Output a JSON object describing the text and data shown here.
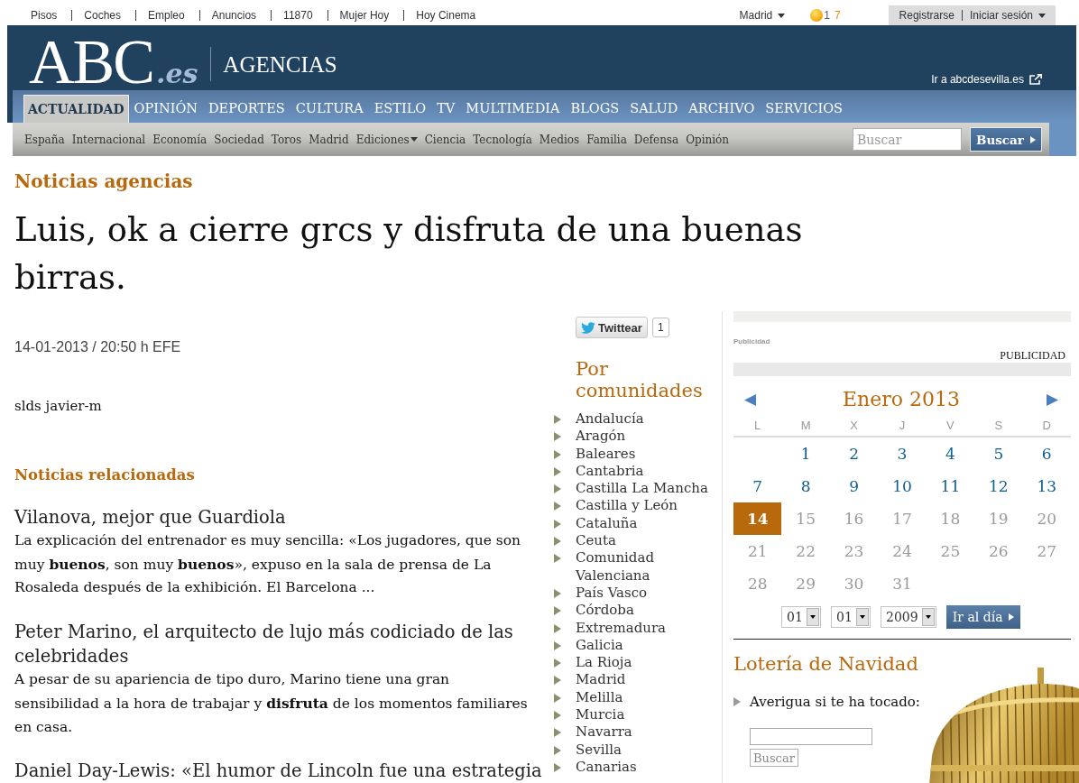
{
  "top_bar": {
    "links": [
      "Pisos",
      "Coches",
      "Empleo",
      "Anuncios",
      "11870",
      "Mujer Hoy",
      "Hoy Cinema"
    ],
    "city": "Madrid",
    "weather": {
      "low": "1",
      "high": "7"
    },
    "account": {
      "register": "Registrarse",
      "login": "Iniciar sesión"
    }
  },
  "header": {
    "logo": {
      "name": "ABC",
      "suffix": ".es"
    },
    "section": "AGENCIAS",
    "edition_link": "Ir a abcdesevilla.es"
  },
  "main_nav": [
    {
      "label": "ACTUALIDAD",
      "selected": true
    },
    {
      "label": "OPINIÓN",
      "selected": false
    },
    {
      "label": "DEPORTES",
      "selected": false
    },
    {
      "label": "CULTURA",
      "selected": false
    },
    {
      "label": "ESTILO",
      "selected": false
    },
    {
      "label": "TV",
      "selected": false
    },
    {
      "label": "MULTIMEDIA",
      "selected": false
    },
    {
      "label": "BLOGS",
      "selected": false
    },
    {
      "label": "SALUD",
      "selected": false
    },
    {
      "label": "ARCHIVO",
      "selected": false
    },
    {
      "label": "SERVICIOS",
      "selected": false
    }
  ],
  "sub_nav": [
    {
      "label": "España",
      "dropdown": false
    },
    {
      "label": "Internacional",
      "dropdown": false
    },
    {
      "label": "Economía",
      "dropdown": false
    },
    {
      "label": "Sociedad",
      "dropdown": false
    },
    {
      "label": "Toros",
      "dropdown": false
    },
    {
      "label": "Madrid",
      "dropdown": false
    },
    {
      "label": "Ediciones",
      "dropdown": true
    },
    {
      "label": "Ciencia",
      "dropdown": false
    },
    {
      "label": "Tecnología",
      "dropdown": false
    },
    {
      "label": "Medios",
      "dropdown": false
    },
    {
      "label": "Familia",
      "dropdown": false
    },
    {
      "label": "Defensa",
      "dropdown": false
    },
    {
      "label": "Opinión",
      "dropdown": false
    }
  ],
  "search": {
    "placeholder": "Buscar",
    "button": "Buscar"
  },
  "article": {
    "kicker": "Noticias agencias",
    "headline": "Luis, ok a cierre grcs y disfruta de una buenas birras.",
    "byline": "14-01-2013 / 20:50 h EFE",
    "body": "slds javier-m"
  },
  "related": {
    "title": "Noticias relacionadas",
    "items": [
      {
        "title": "Vilanova, mejor que Guardiola",
        "summary": "La explicación del entrenador es muy sencilla: «Los jugadores, que son muy **buenos**, son muy **buenos**», expuso en la sala de prensa de La Rosaleda después de la exhibición. El Barcelona ..."
      },
      {
        "title": "Peter Marino, el arquitecto de lujo más codiciado de las celebridades",
        "summary": "A pesar de su apariencia de tipo duro, Marino tiene una gran sensibilidad a la hora de trabajar y **disfruta** de los momentos familiares en casa."
      },
      {
        "title": "Daniel Day-Lewis: «El humor de Lincoln fue una estrategia"
      }
    ]
  },
  "share": {
    "label": "Twittear",
    "count": "1"
  },
  "regions": {
    "title": "Por comunidades",
    "items": [
      "Andalucía",
      "Aragón",
      "Baleares",
      "Cantabria",
      "Castilla La Mancha",
      "Castilla y León",
      "Cataluña",
      "Ceuta",
      "Comunidad Valenciana",
      "País Vasco",
      "Córdoba",
      "Extremadura",
      "Galicia",
      "La Rioja",
      "Madrid",
      "Melilla",
      "Murcia",
      "Navarra",
      "Sevilla",
      "Canarias"
    ]
  },
  "ad": {
    "caption": "Publicidad",
    "label": "PUBLICIDAD"
  },
  "calendar": {
    "month": "Enero 2013",
    "weekdays": [
      "L",
      "M",
      "X",
      "J",
      "V",
      "S",
      "D"
    ],
    "weeks": [
      [
        {
          "day": "1",
          "selected": false,
          "disabled": false
        },
        {
          "day": "2",
          "selected": false,
          "disabled": false
        },
        {
          "day": "3",
          "selected": false,
          "disabled": false
        },
        {
          "day": "4",
          "selected": false,
          "disabled": false
        },
        {
          "day": "5",
          "selected": false,
          "disabled": false
        },
        {
          "day": "6",
          "selected": false,
          "disabled": false
        }
      ],
      [
        {
          "day": "7",
          "selected": false,
          "disabled": false
        },
        {
          "day": "8",
          "selected": false,
          "disabled": false
        },
        {
          "day": "9",
          "selected": false,
          "disabled": false
        },
        {
          "day": "10",
          "selected": false,
          "disabled": false
        },
        {
          "day": "11",
          "selected": false,
          "disabled": false
        },
        {
          "day": "12",
          "selected": false,
          "disabled": false
        },
        {
          "day": "13",
          "selected": false,
          "disabled": false
        }
      ],
      [
        {
          "day": "14",
          "selected": true,
          "disabled": false
        },
        {
          "day": "15",
          "selected": false,
          "disabled": true
        },
        {
          "day": "16",
          "selected": false,
          "disabled": true
        },
        {
          "day": "17",
          "selected": false,
          "disabled": true
        },
        {
          "day": "18",
          "selected": false,
          "disabled": true
        },
        {
          "day": "19",
          "selected": false,
          "disabled": true
        },
        {
          "day": "20",
          "selected": false,
          "disabled": true
        }
      ],
      [
        {
          "day": "21",
          "selected": false,
          "disabled": true
        },
        {
          "day": "22",
          "selected": false,
          "disabled": true
        },
        {
          "day": "23",
          "selected": false,
          "disabled": true
        },
        {
          "day": "24",
          "selected": false,
          "disabled": true
        },
        {
          "day": "25",
          "selected": false,
          "disabled": true
        },
        {
          "day": "26",
          "selected": false,
          "disabled": true
        },
        {
          "day": "27",
          "selected": false,
          "disabled": true
        }
      ],
      [
        {
          "day": "28",
          "selected": false,
          "disabled": true
        },
        {
          "day": "29",
          "selected": false,
          "disabled": true
        },
        {
          "day": "30",
          "selected": false,
          "disabled": true
        },
        {
          "day": "31",
          "selected": false,
          "disabled": true
        }
      ]
    ],
    "selects": [
      "01",
      "01",
      "2009"
    ],
    "go_button": "Ir al día"
  },
  "lottery": {
    "title": "Lotería de Navidad",
    "prompt": "Averigua si te ha tocado:",
    "button": "Buscar"
  }
}
